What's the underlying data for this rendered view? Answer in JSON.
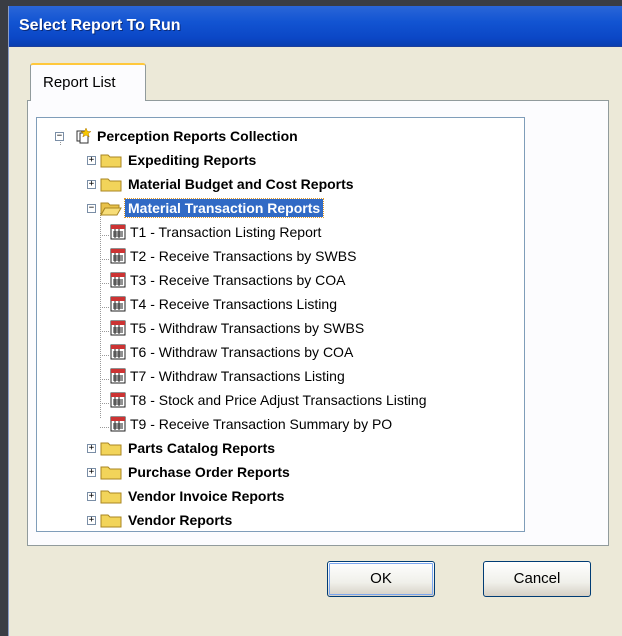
{
  "window": {
    "title": "Select Report To Run"
  },
  "tabs": [
    {
      "label": "Report List"
    }
  ],
  "tree": {
    "root": {
      "label": "Perception Reports Collection",
      "icon": "collection-icon"
    },
    "folders": [
      {
        "label": "Expediting Reports",
        "expanded": false
      },
      {
        "label": "Material Budget and Cost Reports",
        "expanded": false
      },
      {
        "label": "Material Transaction Reports",
        "expanded": true,
        "selected": true
      },
      {
        "label": "Parts Catalog Reports",
        "expanded": false
      },
      {
        "label": "Purchase Order Reports",
        "expanded": false
      },
      {
        "label": "Vendor Invoice Reports",
        "expanded": false
      },
      {
        "label": "Vendor Reports",
        "expanded": false
      }
    ],
    "reports": [
      {
        "label": "T1 - Transaction Listing Report"
      },
      {
        "label": "T2 - Receive Transactions by SWBS"
      },
      {
        "label": "T3 - Receive Transactions by COA"
      },
      {
        "label": "T4 - Receive Transactions Listing"
      },
      {
        "label": "T5 - Withdraw Transactions by SWBS"
      },
      {
        "label": "T6 - Withdraw Transactions by COA"
      },
      {
        "label": "T7 - Withdraw Transactions Listing"
      },
      {
        "label": "T8 - Stock and Price Adjust Transactions Listing"
      },
      {
        "label": "T9 - Receive Transaction Summary by PO"
      }
    ]
  },
  "buttons": {
    "ok": "OK",
    "cancel": "Cancel"
  },
  "colors": {
    "titlebar": "#0b47c6",
    "selection": "#316ac5",
    "folder": "#f2d45a",
    "dialog_bg": "#ece9d8"
  }
}
